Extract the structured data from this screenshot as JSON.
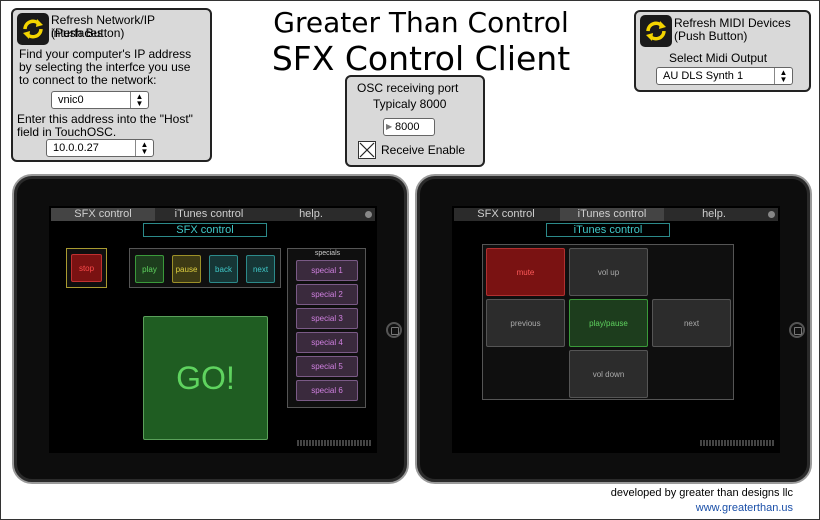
{
  "title": {
    "line1": "Greater Than Control",
    "line2": "SFX Control Client"
  },
  "network_panel": {
    "refresh_label_1": "Refresh Network/IP interfaces",
    "refresh_label_2": "(Push Button)",
    "instructions_1": "Find your computer's IP address",
    "instructions_2": "by selecting the interfce you use",
    "instructions_3": "to connect to the network:",
    "interface_value": "vnic0",
    "host_label_1": "Enter this address into the \"Host\"",
    "host_label_2": "field in TouchOSC.",
    "ip_value": "10.0.0.27"
  },
  "osc_panel": {
    "label": "OSC receiving port",
    "hint": "Typicaly 8000",
    "port_value": "8000",
    "receive_label": "Receive Enable",
    "receive_checked": true
  },
  "midi_panel": {
    "refresh_label_1": "Refresh MIDI Devices",
    "refresh_label_2": "(Push Button)",
    "select_label": "Select Midi Output",
    "output_value": "AU DLS Synth 1"
  },
  "ipad_left": {
    "tabs": [
      "SFX control",
      "iTunes control",
      "help."
    ],
    "screen_title": "SFX control",
    "stop": "stop",
    "transport": [
      "play",
      "pause",
      "back",
      "next"
    ],
    "specials_header": "specials",
    "specials": [
      "special 1",
      "special 2",
      "special 3",
      "special 4",
      "special 5",
      "special 6"
    ],
    "go": "GO!"
  },
  "ipad_right": {
    "tabs": [
      "SFX control",
      "iTunes control",
      "help."
    ],
    "screen_title": "iTunes control",
    "buttons": {
      "mute": "mute",
      "vol_up": "vol up",
      "previous": "previous",
      "play_pause": "play/pause",
      "next": "next",
      "vol_down": "vol down"
    }
  },
  "footer": {
    "credit": "developed by greater than designs llc",
    "url": "www.greaterthan.us"
  },
  "colors": {
    "panel_bg": "#d9d9d9",
    "teal": "#40c8c8",
    "link_blue": "#1a4fa8",
    "go_green": "#2e7d32"
  }
}
